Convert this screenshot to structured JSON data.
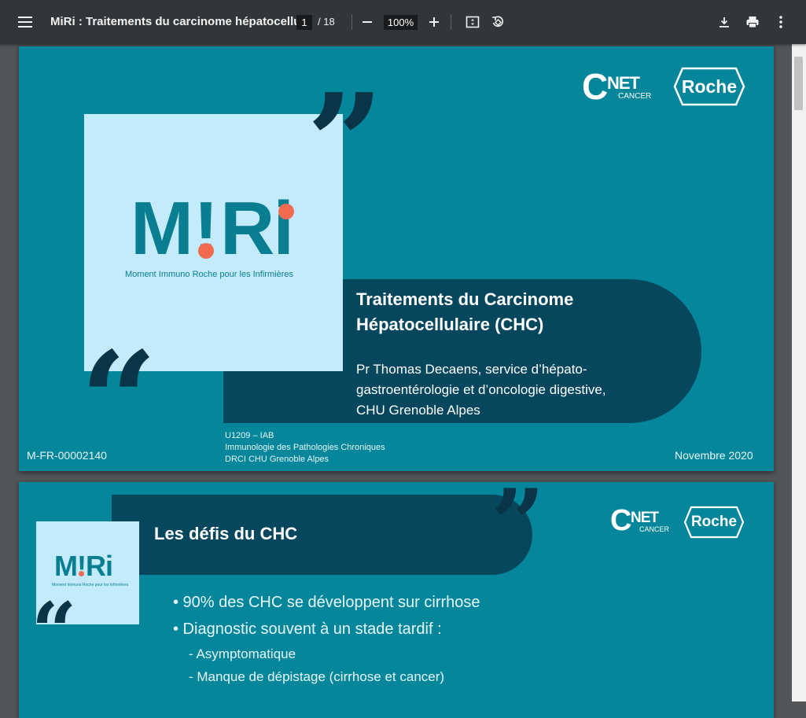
{
  "toolbar": {
    "title": "MiRi : Traitements du carcinome hépatocellu...",
    "page_current": "1",
    "page_total": "/ 18",
    "zoom": "100%",
    "icons": [
      "menu-icon",
      "zoom-out-icon",
      "zoom-in-icon",
      "fit-page-icon",
      "rotate-icon",
      "download-icon",
      "print-icon",
      "more-icon"
    ]
  },
  "logos": {
    "cnet_letter": "C",
    "cnet_net": "NET",
    "cnet_cancer": "CANCER",
    "roche": "Roche"
  },
  "slide1": {
    "miri_m": "M",
    "miri_i1": "!",
    "miri_ri": "Ri",
    "miri_tagline": "Moment Immuno Roche pour les Infirmières",
    "title_line1": "Traitements du Carcinome",
    "title_line2": "Hépatocellulaire (CHC)",
    "author_line1": "Pr Thomas Decaens, service d’hépato-",
    "author_line2": "gastroentérologie et d’oncologie digestive,",
    "author_line3": "CHU Grenoble Alpes",
    "affil_line1": "U1209 – IAB",
    "affil_line2": "Immunologie des Pathologies Chroniques",
    "affil_line3": "DRCI CHU Grenoble Alpes",
    "code": "M-FR-00002140",
    "date": "Novembre 2020"
  },
  "slide2": {
    "miri_tagline": "Moment Immuno Roche pour les Infirmières",
    "title": "Les défis du CHC",
    "bullets": [
      "• 90% des CHC se développent sur cirrhose",
      "• Diagnostic souvent à un stade tardif :"
    ],
    "subbullets": [
      "- Asymptomatique",
      "- Manque de dépistage (cirrhose et cancer)"
    ]
  },
  "colors": {
    "toolbar": "#323639",
    "viewer_bg": "#525659",
    "slide_teal": "#05869a",
    "banner_dark": "#06475e",
    "miri_box": "#c3ebfb",
    "miri_accent": "#f26b50"
  }
}
